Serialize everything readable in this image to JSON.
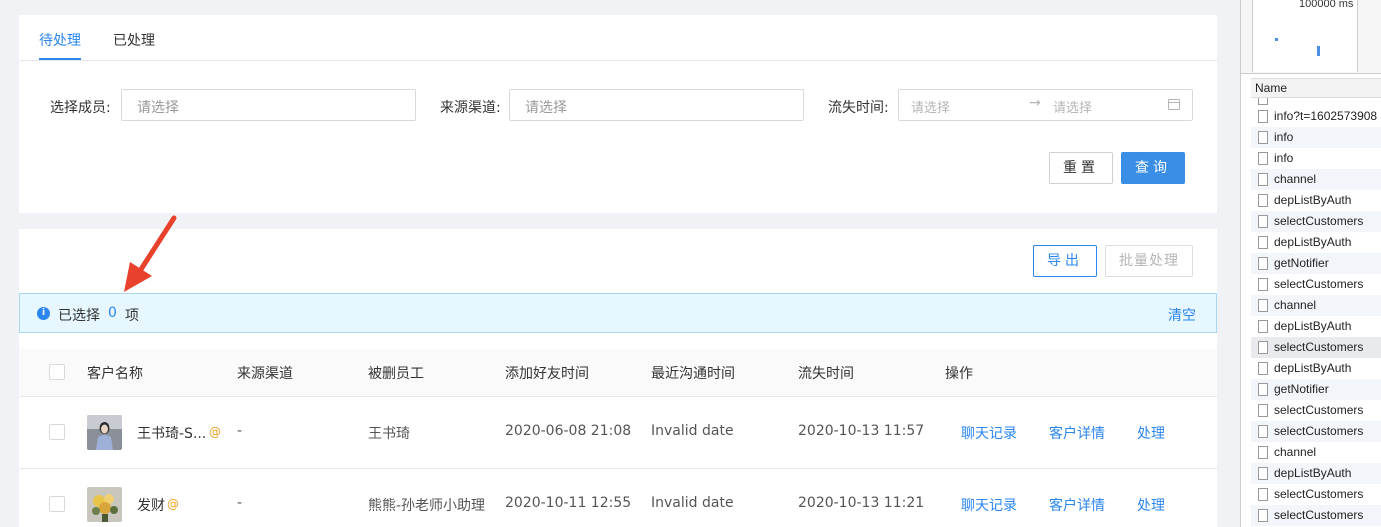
{
  "tabs": [
    {
      "label": "待处理",
      "active": true
    },
    {
      "label": "已处理",
      "active": false
    }
  ],
  "filters": {
    "member_label": "选择成员:",
    "member_placeholder": "请选择",
    "channel_label": "来源渠道:",
    "channel_placeholder": "请选择",
    "time_label": "流失时间:",
    "time_start_placeholder": "请选择",
    "time_end_placeholder": "请选择",
    "range_arrow": "→"
  },
  "buttons": {
    "reset": "重置",
    "query": "查询",
    "export": "导出",
    "batch": "批量处理"
  },
  "selection": {
    "prefix": "已选择",
    "count": "0",
    "suffix": "项",
    "clear": "清空"
  },
  "table": {
    "headers": [
      "客户名称",
      "来源渠道",
      "被删员工",
      "添加好友时间",
      "最近沟通时间",
      "流失时间",
      "操作"
    ],
    "rows": [
      {
        "name": "王书琦-S...",
        "at": "@",
        "channel": "-",
        "employee": "王书琦",
        "added": "2020-06-08 21:08",
        "last_contact": "Invalid date",
        "lost": "2020-10-13 11:57",
        "actions": [
          "聊天记录",
          "客户详情",
          "处理"
        ]
      },
      {
        "name": "发财",
        "at": "@",
        "channel": "-",
        "employee": "熊熊-孙老师小助理",
        "added": "2020-10-11 12:55",
        "last_contact": "Invalid date",
        "lost": "2020-10-13 11:21",
        "actions": [
          "聊天记录",
          "客户详情",
          "处理"
        ]
      }
    ]
  },
  "devtools": {
    "timeline_label": "100000 ms",
    "column_header": "Name",
    "requests": [
      "",
      "info?t=1602573908",
      "info",
      "info",
      "channel",
      "depListByAuth",
      "selectCustomers",
      "depListByAuth",
      "getNotifier",
      "selectCustomers",
      "channel",
      "depListByAuth",
      "selectCustomers",
      "depListByAuth",
      "getNotifier",
      "selectCustomers",
      "selectCustomers",
      "channel",
      "depListByAuth",
      "selectCustomers",
      "selectCustomers"
    ]
  },
  "colors": {
    "accent": "#2b86f0",
    "annotation_arrow": "#e8412c",
    "alert_bg": "#e6f7ff"
  }
}
